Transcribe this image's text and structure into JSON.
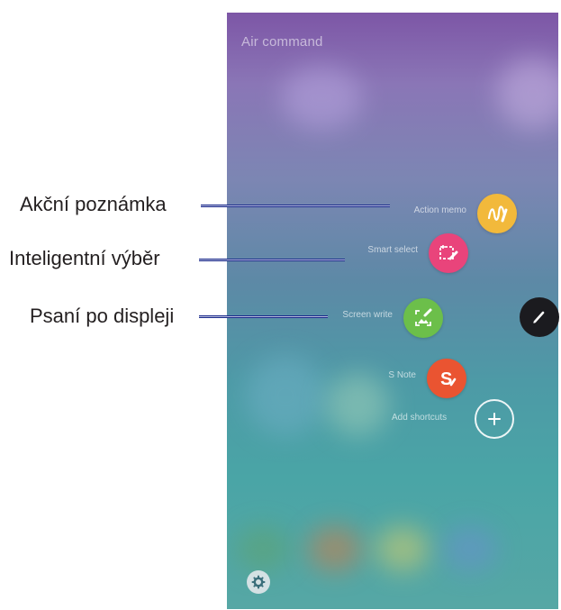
{
  "screen": {
    "title": "Air command"
  },
  "menu": {
    "items": [
      {
        "label": "Action memo",
        "icon": "action-memo-icon",
        "color": "#f2b93b"
      },
      {
        "label": "Smart select",
        "icon": "smart-select-icon",
        "color": "#e9447b"
      },
      {
        "label": "Screen write",
        "icon": "screen-write-icon",
        "color": "#6cbf4a"
      },
      {
        "label": "S Note",
        "icon": "s-note-icon",
        "color": "#ea5431"
      }
    ],
    "add_shortcuts_label": "Add shortcuts",
    "add_icon": "plus-icon",
    "pen_icon": "pen-icon",
    "settings_icon": "gear-icon"
  },
  "callouts": [
    "Akční poznámka",
    "Inteligentní výběr",
    "Psaní po displeji"
  ],
  "colors": {
    "leader_line": "#1b2a8c",
    "pen_button": "#1b1b1f"
  }
}
